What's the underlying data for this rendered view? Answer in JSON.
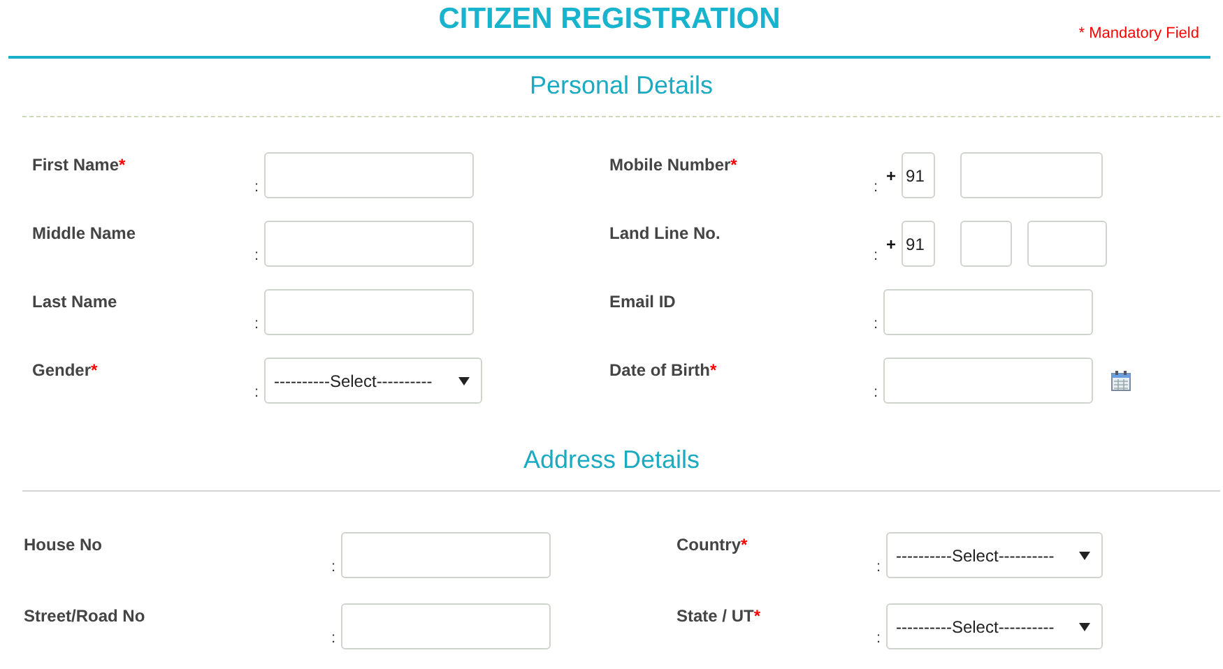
{
  "title": "CITIZEN REGISTRATION",
  "mandatory_note": "* Mandatory Field",
  "sections": [
    {
      "title": "Personal Details",
      "fields": [
        {
          "label": "First Name",
          "required_mark": "*",
          "separator": ":",
          "kind": "text"
        },
        {
          "label": "Mobile Number",
          "required_mark": "*",
          "separator": ":",
          "kind": "mobile",
          "prefix": "+",
          "code": "91"
        },
        {
          "label": "Middle Name",
          "separator": ":",
          "kind": "text"
        },
        {
          "label": "Land Line No.",
          "separator": ":",
          "kind": "landline",
          "prefix": "+",
          "code": "91"
        },
        {
          "label": "Last Name",
          "separator": ":",
          "kind": "text"
        },
        {
          "label": "Email ID",
          "separator": ":",
          "kind": "text"
        },
        {
          "label": "Gender",
          "required_mark": "*",
          "separator": ":",
          "kind": "select",
          "value": "----------Select----------"
        },
        {
          "label": "Date of Birth",
          "required_mark": "*",
          "separator": ":",
          "kind": "date"
        }
      ]
    },
    {
      "title": "Address Details",
      "fields": [
        {
          "label": "House No",
          "separator": ":",
          "kind": "text"
        },
        {
          "label": "Country",
          "required_mark": "*",
          "separator": ":",
          "kind": "select",
          "value": "----------Select----------"
        },
        {
          "label": "Street/Road No",
          "separator": ":",
          "kind": "text"
        },
        {
          "label": "State / UT",
          "required_mark": "*",
          "separator": ":",
          "kind": "select",
          "value": "----------Select----------"
        }
      ]
    }
  ]
}
